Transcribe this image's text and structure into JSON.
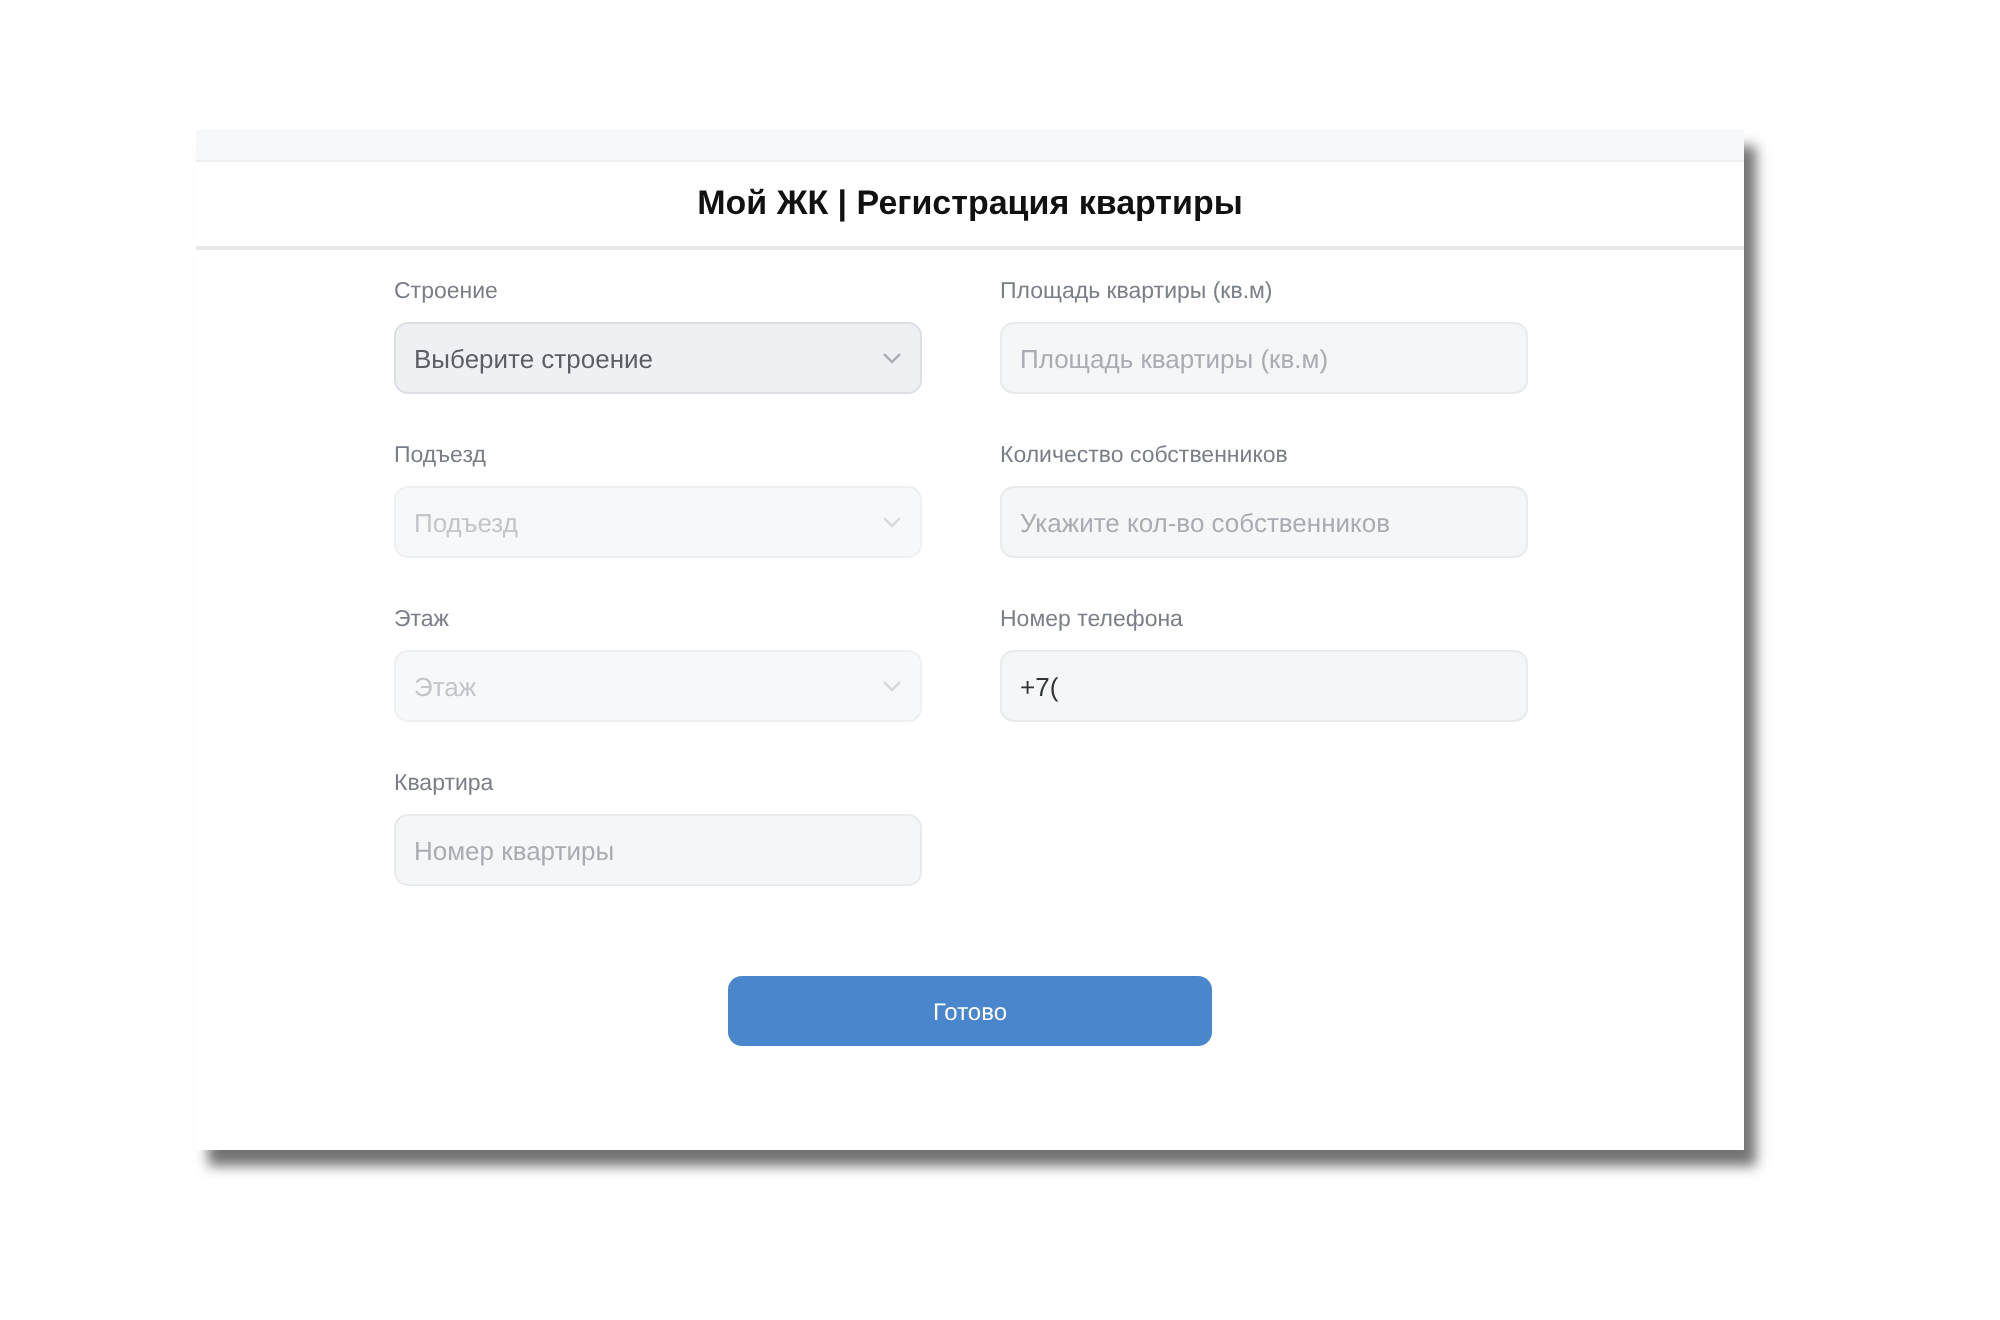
{
  "window": {
    "title": "Мой ЖК | Регистрация квартиры"
  },
  "form": {
    "columns": [
      [
        {
          "kind": "select",
          "label": "Строение",
          "placeholder": "Выберите строение",
          "disabled": false
        },
        {
          "kind": "select",
          "label": "Подъезд",
          "placeholder": "Подъезд",
          "disabled": true
        },
        {
          "kind": "select",
          "label": "Этаж",
          "placeholder": "Этаж",
          "disabled": true
        },
        {
          "kind": "input",
          "label": "Квартира",
          "placeholder": "Номер квартиры",
          "disabled": false
        }
      ],
      [
        {
          "kind": "input",
          "label": "Площадь квартиры (кв.м)",
          "placeholder": "Площадь квартиры (кв.м)",
          "disabled": false
        },
        {
          "kind": "input",
          "label": "Количество собственников",
          "placeholder": "Укажите кол-во собственников",
          "disabled": false
        },
        {
          "kind": "input",
          "label": "Номер телефона",
          "value": "+7(",
          "disabled": false
        }
      ]
    ]
  },
  "submit_button": "Готово"
}
